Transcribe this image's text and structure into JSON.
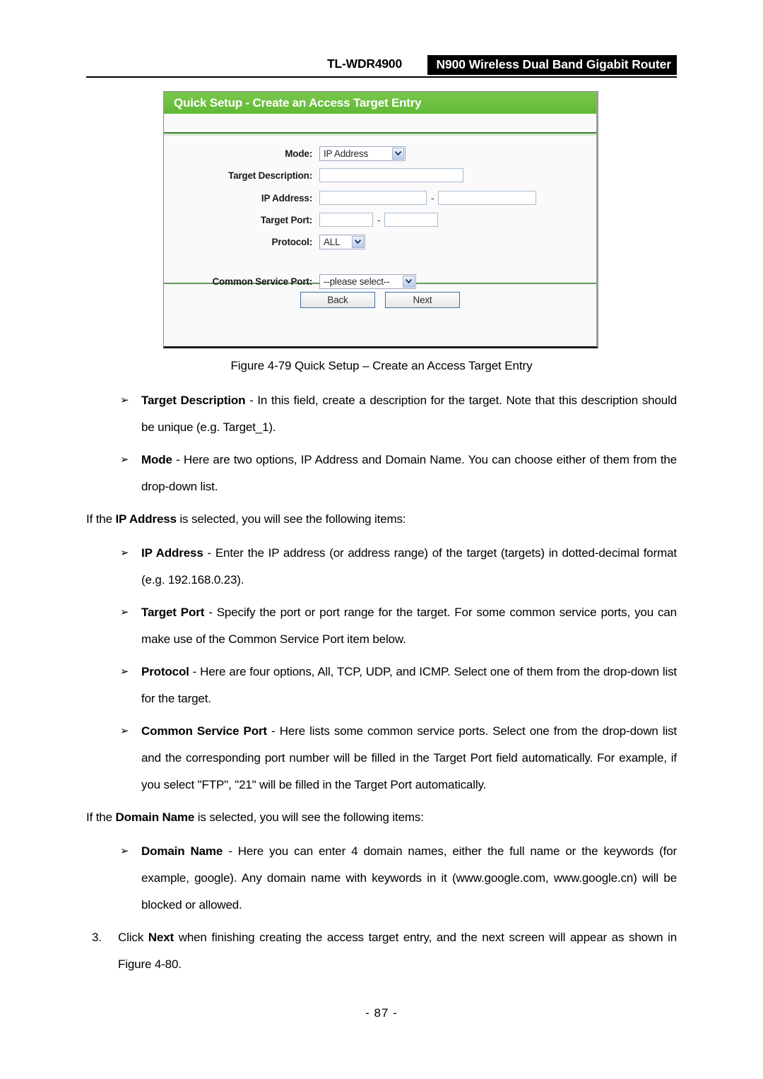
{
  "header": {
    "model": "TL-WDR4900",
    "product": "N900 Wireless Dual Band Gigabit Router"
  },
  "router_ui": {
    "title": "Quick Setup - Create an Access Target Entry",
    "accent_color": "#6cbf3e",
    "fields": {
      "mode_label": "Mode:",
      "mode_value": "IP Address",
      "target_description_label": "Target Description:",
      "target_description_value": "",
      "ip_address_label": "IP Address:",
      "ip_address_start_value": "",
      "ip_address_end_value": "",
      "ip_range_separator": "-",
      "target_port_label": "Target Port:",
      "target_port_start_value": "",
      "target_port_end_value": "",
      "target_port_separator": "-",
      "protocol_label": "Protocol:",
      "protocol_value": "ALL",
      "common_service_port_label": "Common Service Port:",
      "common_service_port_value": "--please select--"
    },
    "buttons": {
      "back": "Back",
      "next": "Next"
    }
  },
  "figure": {
    "caption": "Figure 4-79 Quick Setup – Create an Access Target Entry"
  },
  "content": {
    "bullet_target_description": {
      "term": "Target Description",
      "body": " - In this field, create a description for the target. Note that this description should be unique (e.g. Target_1)."
    },
    "bullet_mode": {
      "term": "Mode",
      "body": " - Here are two options, IP Address and Domain Name. You can choose either of them from the drop-down list."
    },
    "para_if_ip": {
      "lead": "If the ",
      "term": "IP Address",
      "tail": " is selected, you will see the following items:"
    },
    "bullet_ip_address": {
      "term": "IP Address",
      "body": " - Enter the IP address (or address range) of the target (targets) in dotted-decimal format (e.g. 192.168.0.23)."
    },
    "bullet_target_port": {
      "term": "Target Port",
      "body": " - Specify the port or port range for the target. For some common service ports, you can make use of the Common Service Port item below."
    },
    "bullet_protocol": {
      "term": "Protocol",
      "body": " - Here are four options, All, TCP, UDP, and ICMP. Select one of them from the drop-down list for the target."
    },
    "bullet_common_service_port": {
      "term": "Common Service Port",
      "body": " - Here lists some common service ports. Select one from the drop-down list and the corresponding port number will be filled in the Target Port field automatically. For example, if you select \"FTP\", \"21\" will be filled in the Target Port automatically."
    },
    "para_if_domain": {
      "lead": "If the ",
      "term": "Domain Name",
      "tail": " is selected, you will see the following items:"
    },
    "bullet_domain_name": {
      "term": "Domain Name",
      "body": " - Here you can enter 4 domain names, either the full name or the keywords (for example, google). Any domain name with keywords in it (www.google.com, www.google.cn) will be blocked or allowed."
    },
    "step_three": {
      "number": "3.",
      "lead": "Click ",
      "term": "Next",
      "tail": " when finishing creating the access target entry, and the next screen will appear as shown in Figure 4-80."
    },
    "bullet_glyph": "➢"
  },
  "footer": {
    "page_number": "- 87 -"
  }
}
